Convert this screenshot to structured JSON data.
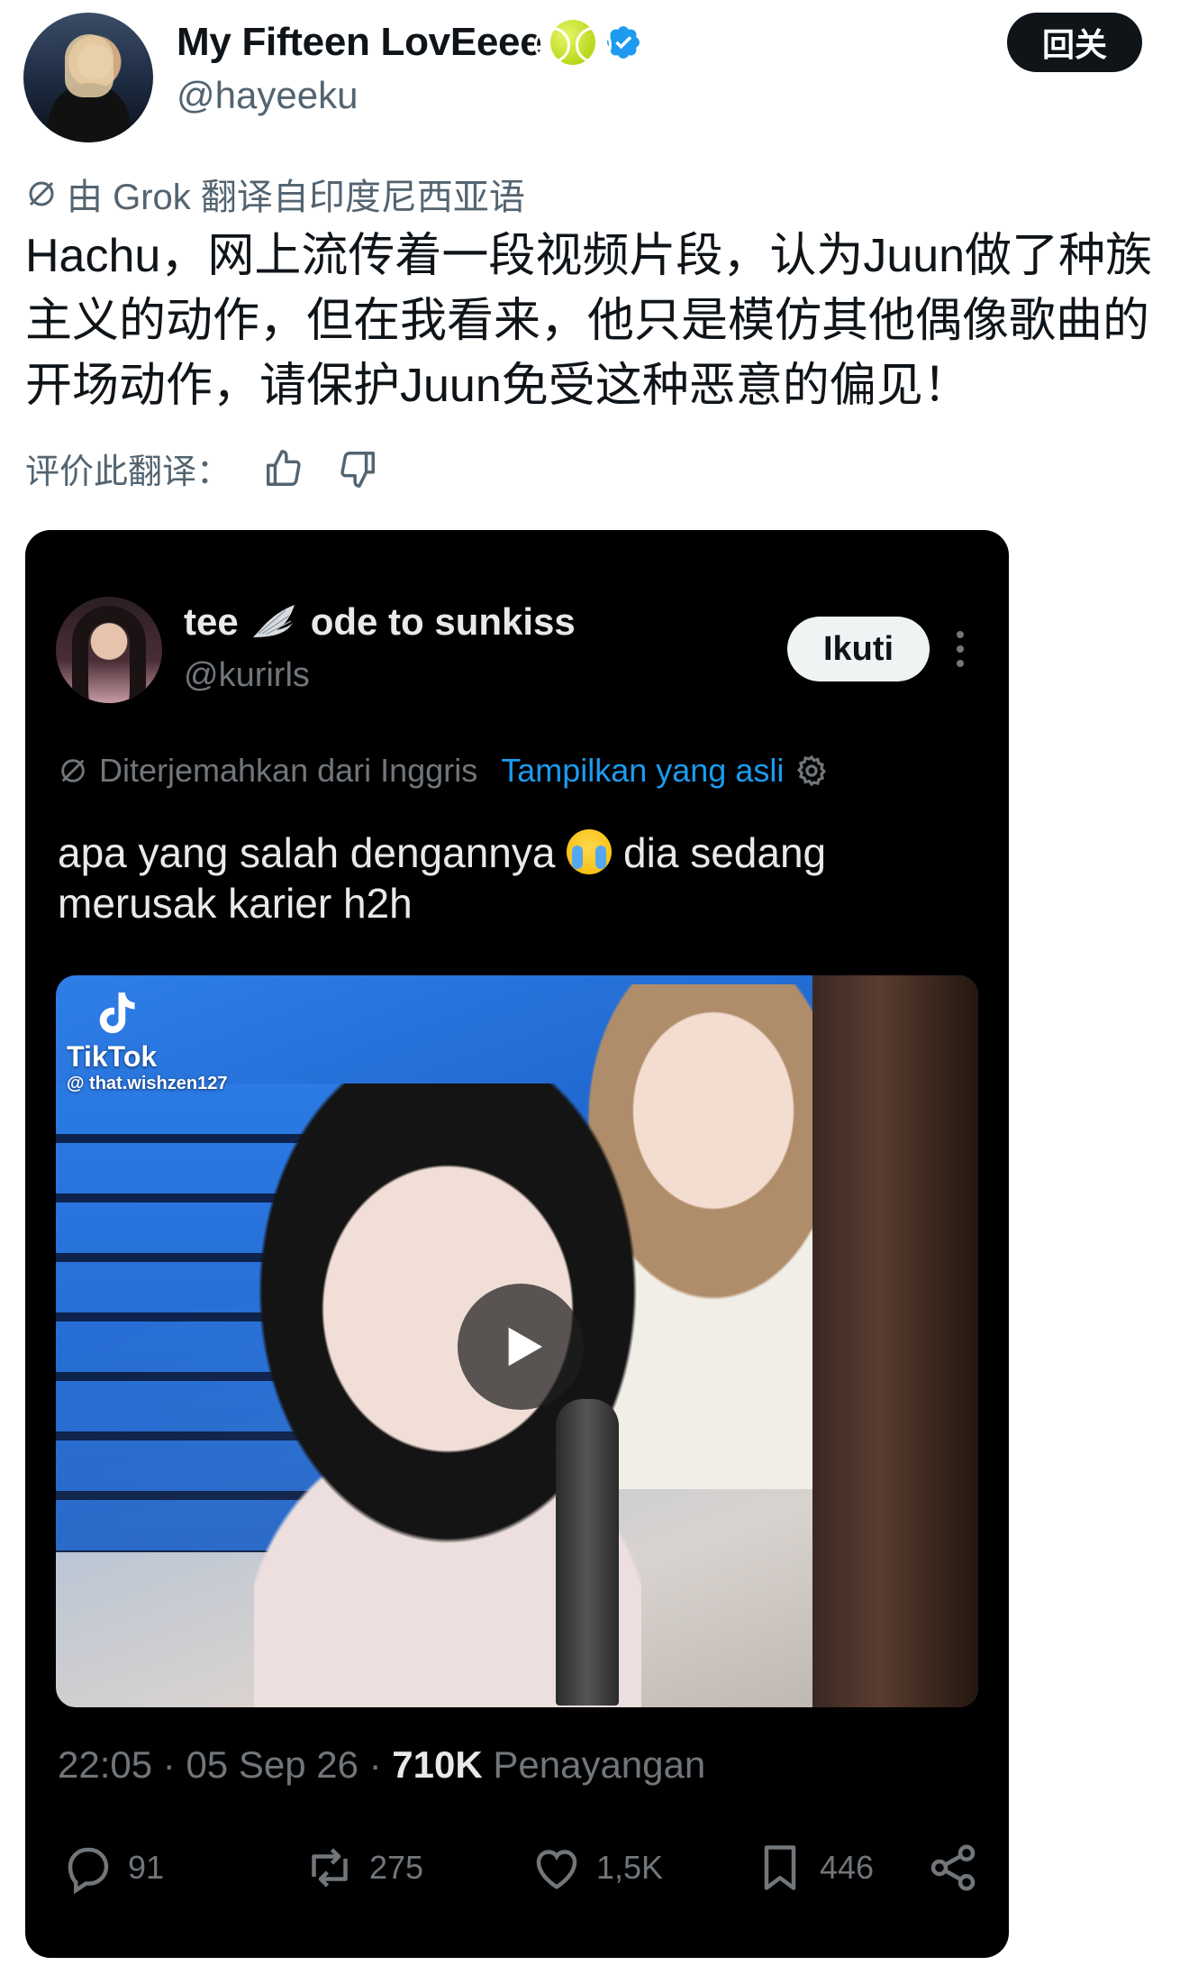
{
  "header": {
    "display_name": "My Fifteen LovEeee",
    "handle": "@hayeeku",
    "unfollow_label": "回关"
  },
  "translation": {
    "translated_by": "由 Grok 翻译自印度尼西亚语",
    "text": "Hachu，网上流传着一段视频片段，认为Juun做了种族主义的动作，但在我看来，他只是模仿其他偶像歌曲的开场动作，请保护Juun免受这种恶意的偏见！",
    "rate_label": "评价此翻译："
  },
  "quoted": {
    "name_part1": "tee",
    "name_part2": "ode to sunkiss",
    "handle": "@kurirls",
    "follow_label": "Ikuti",
    "translated_from": "Diterjemahkan dari Inggris",
    "show_original": "Tampilkan yang asli",
    "text_before_emoji": "apa yang salah dengannya",
    "text_after_emoji": " dia sedang merusak karier h2h",
    "video": {
      "tiktok_name": "TikTok",
      "tiktok_user": "@ that.wishzen127"
    },
    "meta": {
      "time": "22:05",
      "date": "05 Sep 26",
      "views_count": "710K",
      "views_label": "Penayangan"
    },
    "actions": {
      "replies": "91",
      "reposts": "275",
      "likes": "1,5K",
      "bookmarks": "446"
    }
  },
  "colors": {
    "accent": "#1d9bf0",
    "text_primary": "#0f1419",
    "text_secondary": "#536471",
    "card_bg": "#000000"
  }
}
